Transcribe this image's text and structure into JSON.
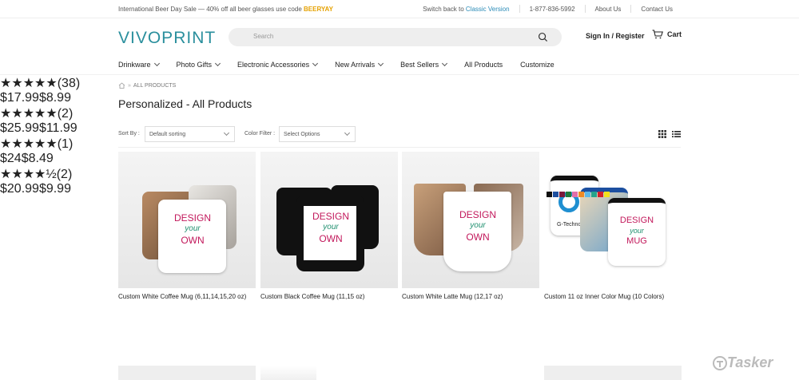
{
  "topbar": {
    "promo_text": "International Beer Day Sale — 40% off all beer glasses use code",
    "promo_code": "BEERYAY",
    "switch_text": "Switch back to",
    "switch_link": "Classic Version",
    "phone": "1-877-836-5992",
    "about": "About Us",
    "contact": "Contact Us"
  },
  "header": {
    "logo": "VIVOPRINT",
    "search_placeholder": "Search",
    "signin": "Sign In / Register",
    "cart": "Cart"
  },
  "nav": {
    "items": [
      {
        "label": "Drinkware"
      },
      {
        "label": "Photo Gifts"
      },
      {
        "label": "Electronic Accessories"
      },
      {
        "label": "New Arrivals"
      },
      {
        "label": "Best Sellers"
      },
      {
        "label": "All Products"
      },
      {
        "label": "Customize"
      }
    ]
  },
  "breadcrumb": {
    "current": "ALL PRODUCTS"
  },
  "page_title": "Personalized - All Products",
  "sortbar": {
    "sort_label": "Sort By :",
    "sort_value": "Default sorting",
    "color_label": "Color Filter :",
    "color_value": "Select Options"
  },
  "products": [
    {
      "name": "Custom White Coffee Mug (6,11,14,15,20 oz)",
      "rating": 5,
      "reviews": "(38)",
      "old_price": "$17.99",
      "price": "$8.99"
    },
    {
      "name": "Custom Black Coffee Mug (11,15 oz)",
      "rating": 5,
      "reviews": "(2)",
      "old_price": "$25.99",
      "price": "$11.99"
    },
    {
      "name": "Custom White Latte Mug (12,17 oz)",
      "rating": 5,
      "reviews": "(1)",
      "old_price": "$24",
      "price": "$8.49"
    },
    {
      "name": "Custom 11 oz Inner Color Mug (10 Colors)",
      "rating": 4.5,
      "reviews": "(2)",
      "old_price": "$20.99",
      "price": "$9.99"
    }
  ],
  "mug_text": {
    "design": "DESIGN",
    "your": "your",
    "own": "OWN",
    "mug": "MUG",
    "brand": "G-Techno"
  },
  "swatch_colors": [
    "#111111",
    "#1c4fa0",
    "#7a1a3a",
    "#1f7a3a",
    "#e26ea8",
    "#f08a24",
    "#5db7e8",
    "#27a38c",
    "#d3202a",
    "#f3e11b"
  ],
  "watermark": "Tasker"
}
